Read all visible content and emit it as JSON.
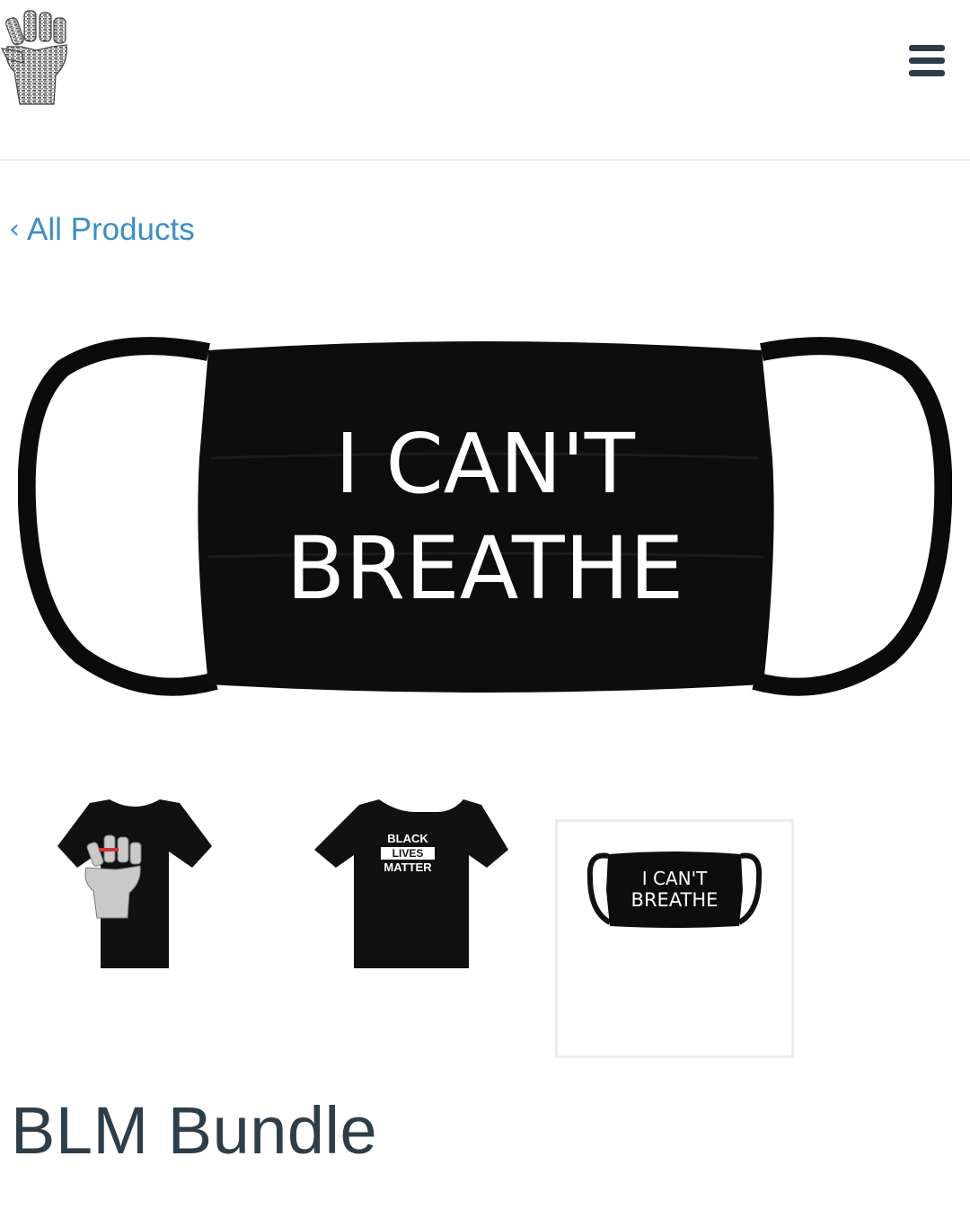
{
  "header": {
    "logo_icon": "raised-fist-icon",
    "menu_icon": "hamburger-menu-icon"
  },
  "nav": {
    "back_chevron": "‹",
    "back_label": "All Products"
  },
  "hero": {
    "line1": "I CAN'T",
    "line2": "BREATHE"
  },
  "thumbnails": [
    {
      "name": "fist-tshirt",
      "text": ""
    },
    {
      "name": "black-lives-matter-tshirt",
      "line1": "BLACK",
      "line2": "LIVES",
      "line3": "MATTER"
    },
    {
      "name": "i-cant-breathe-mask",
      "line1": "I CAN'T",
      "line2": "BREATHE",
      "selected": true
    }
  ],
  "product": {
    "title": "BLM Bundle"
  },
  "colors": {
    "link": "#3a8fc4",
    "title": "#2e3e49",
    "menu": "#2d3d48",
    "divider": "#e8eef2",
    "selected_border": "#e6edf2"
  }
}
